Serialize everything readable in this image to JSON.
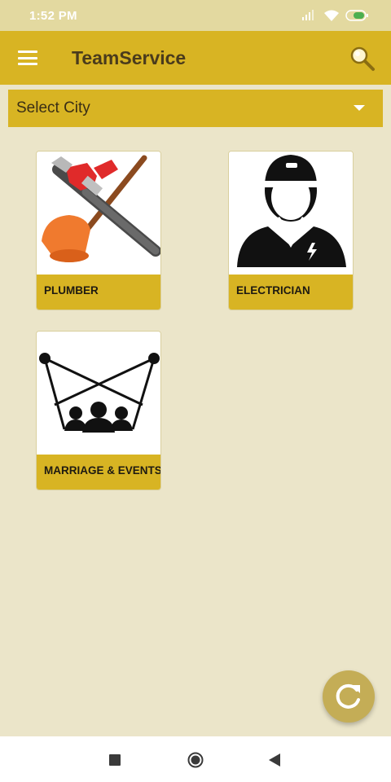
{
  "status_bar": {
    "time": "1:52 PM",
    "icons": [
      "signal-icon",
      "wifi-icon",
      "battery-icon"
    ]
  },
  "app_bar": {
    "title": "TeamService",
    "menu_icon": "menu-icon",
    "search_icon": "search-icon"
  },
  "city_select": {
    "selected": "Select City"
  },
  "services": [
    {
      "label": "PLUMBER",
      "icon": "plumber-tools-icon"
    },
    {
      "label": "ELECTRICIAN",
      "icon": "electrician-icon"
    },
    {
      "label": "MARRIAGE & EVENTS",
      "icon": "events-lights-icon"
    }
  ],
  "fab": {
    "icon": "refresh-icon"
  },
  "nav_bar": {
    "icons": [
      "recent-apps-icon",
      "home-icon",
      "back-icon"
    ]
  },
  "colors": {
    "background": "#ebe5c9",
    "accent": "#d8b423",
    "fab": "#c4ad56",
    "status_bar": "#e3d9a0"
  }
}
